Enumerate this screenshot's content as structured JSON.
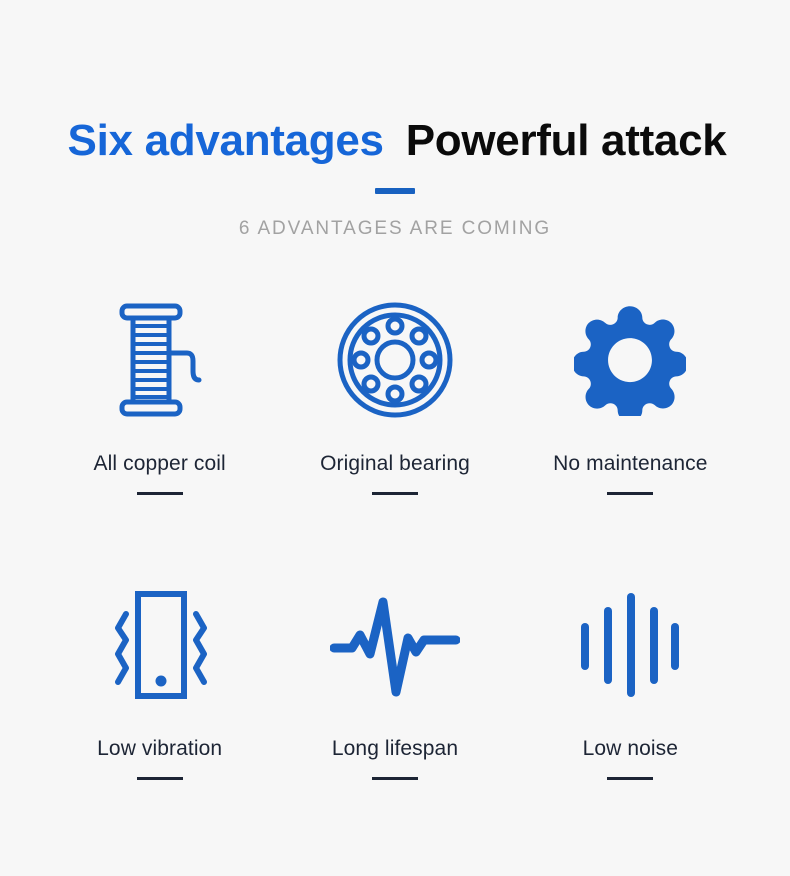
{
  "header": {
    "headline_highlight": "Six advantages",
    "headline_main": "Powerful attack",
    "subtitle": "6 ADVANTAGES ARE COMING"
  },
  "colors": {
    "background": "#f7f7f7",
    "accent_blue": "#1b63c4",
    "headline_blue": "#1666d8",
    "rule_blue": "#1861c0",
    "label_dark": "#1d2535",
    "subtitle_gray": "#a2a2a2"
  },
  "features": [
    {
      "label": "All copper coil",
      "icon": "coil-spool-icon"
    },
    {
      "label": "Original bearing",
      "icon": "ball-bearing-icon"
    },
    {
      "label": "No maintenance",
      "icon": "gear-icon"
    },
    {
      "label": "Low vibration",
      "icon": "vibrating-device-icon"
    },
    {
      "label": "Long lifespan",
      "icon": "heartbeat-waveform-icon"
    },
    {
      "label": "Low noise",
      "icon": "audio-level-bars-icon"
    }
  ]
}
